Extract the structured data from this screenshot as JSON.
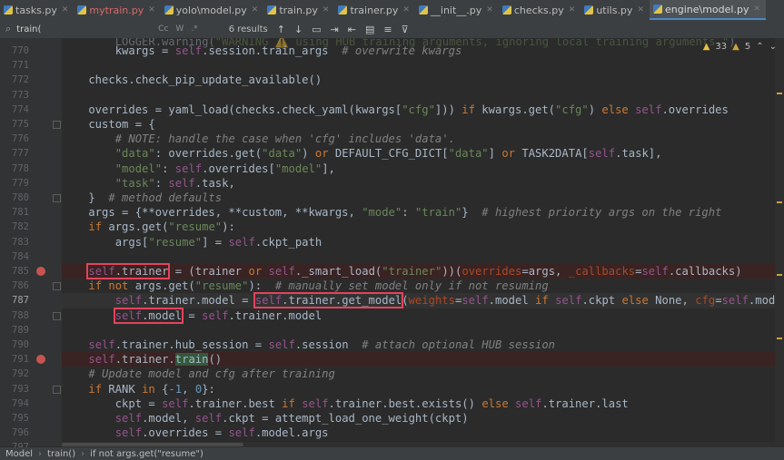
{
  "tabs": [
    {
      "label": "tasks.py",
      "modified": false,
      "active": false
    },
    {
      "label": "mytrain.py",
      "modified": true,
      "active": false
    },
    {
      "label": "yolo\\model.py",
      "modified": false,
      "active": false
    },
    {
      "label": "train.py",
      "modified": false,
      "active": false
    },
    {
      "label": "trainer.py",
      "modified": false,
      "active": false
    },
    {
      "label": "__init__.py",
      "modified": false,
      "active": false
    },
    {
      "label": "checks.py",
      "modified": false,
      "active": false
    },
    {
      "label": "utils.py",
      "modified": false,
      "active": false
    },
    {
      "label": "engine\\model.py",
      "modified": false,
      "active": true
    }
  ],
  "search": {
    "value": "train(",
    "results": "6 results",
    "opt_cc": "Cc",
    "opt_w": "W",
    "opt_re": ".*"
  },
  "inspections": {
    "warnings": "33",
    "weak": "5"
  },
  "breadcrumb": [
    "Model",
    "train()",
    "if not args.get(\"resume\")"
  ],
  "line_numbers": [
    "770",
    "771",
    "772",
    "773",
    "774",
    "775",
    "776",
    "777",
    "778",
    "779",
    "780",
    "781",
    "782",
    "783",
    "784",
    "785",
    "786",
    "787",
    "788",
    "789",
    "790",
    "791",
    "792",
    "793",
    "794",
    "795",
    "796",
    "797"
  ],
  "colors": {
    "breakpoint": "#c75450",
    "highlight_box": "#e5435b",
    "background": "#2b2b2b"
  }
}
